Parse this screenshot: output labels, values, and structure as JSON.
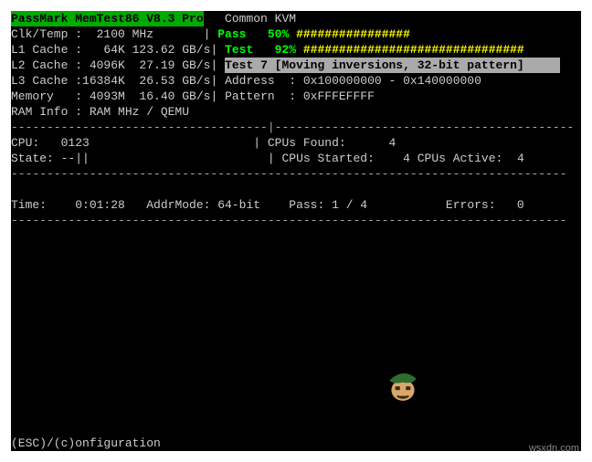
{
  "header": {
    "title": "PassMark MemTest86 V8.3 Pro",
    "system": "Common KVM"
  },
  "info": {
    "clk_label": "Clk/Temp :",
    "clk_val": "  2100 MHz       ",
    "l1_label": "L1 Cache :",
    "l1_val": "   64K 123.62 GB/s",
    "l2_label": "L2 Cache :",
    "l2_val": " 4096K  27.19 GB/s",
    "l3_label": "L3 Cache :",
    "l3_val": "16384K  26.53 GB/s",
    "mem_label": "Memory   :",
    "mem_val": " 4093M  16.40 GB/s",
    "ram_label": "RAM Info :",
    "ram_val": " RAM MHz / QEMU"
  },
  "progress": {
    "pass_label": "Pass",
    "pass_pct": "   50%",
    "pass_bar": " ################",
    "test_label": "Test",
    "test_pct": "   92%",
    "test_bar": " ###############################",
    "test_name": "Test 7 [Moving inversions, 32-bit pattern]     ",
    "addr_label": "Address  :",
    "addr_val": " 0x100000000 - 0x140000000",
    "pat_label": "Pattern  :",
    "pat_val": " 0xFFFEFFFF"
  },
  "cpu": {
    "cpu_label": "CPU:",
    "cpu_val": "   0123                       ",
    "state_label": "State:",
    "state_val": " --||                         ",
    "found_label": "CPUs Found:",
    "found_val": "      4",
    "started_label": "CPUs Started:",
    "started_val": "    4",
    "active_label": "CPUs Active:",
    "active_val": "  4"
  },
  "status": {
    "time_label": "Time:",
    "time_val": "    0:01:28   ",
    "addrm_label": "AddrMode:",
    "addrm_val": " 64-bit    ",
    "pass_label": "Pass:",
    "pass_val": " 1 / 4           ",
    "err_label": "Errors:",
    "err_val": "   0"
  },
  "dividers": {
    "short": "------------------------------------",
    "full": "------------------------------------------------------------------------------"
  },
  "footer": "(ESC)/(c)onfiguration",
  "watermark": "wsxdn.com"
}
